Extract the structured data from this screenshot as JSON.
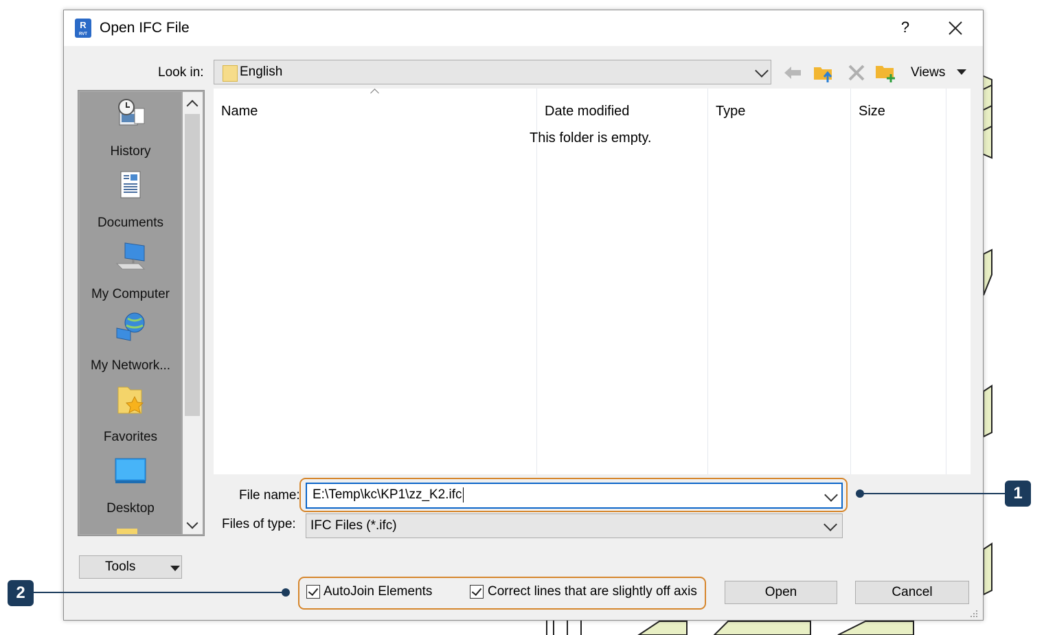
{
  "window": {
    "title": "Open IFC File",
    "app_icon": "revit-app-icon",
    "help": "?",
    "close": "×"
  },
  "lookin": {
    "label": "Look in:",
    "value": "English"
  },
  "toolbar": {
    "views_label": "Views",
    "icons": [
      "back-arrow-icon",
      "up-folder-icon",
      "delete-icon",
      "new-folder-icon"
    ]
  },
  "places": [
    {
      "label": "History",
      "icon": "history-icon"
    },
    {
      "label": "Documents",
      "icon": "documents-icon"
    },
    {
      "label": "My Computer",
      "icon": "my-computer-icon"
    },
    {
      "label": "My Network...",
      "icon": "my-network-icon"
    },
    {
      "label": "Favorites",
      "icon": "favorites-icon"
    },
    {
      "label": "Desktop",
      "icon": "desktop-icon"
    }
  ],
  "file_list": {
    "columns": [
      "Name",
      "Date modified",
      "Type",
      "Size"
    ],
    "empty_message": "This folder is empty."
  },
  "file_name": {
    "label": "File name:",
    "value": "E:\\Temp\\kc\\KP1\\zz_K2.ifc"
  },
  "file_type": {
    "label": "Files of type:",
    "value": "IFC Files (*.ifc)"
  },
  "tools_label": "Tools",
  "options": {
    "autojoin_label": "AutoJoin Elements",
    "autojoin_checked": true,
    "correct_lines_label": "Correct lines that are slightly off axis",
    "correct_lines_checked": true
  },
  "buttons": {
    "open": "Open",
    "cancel": "Cancel"
  },
  "callouts": [
    "1",
    "2"
  ],
  "colors": {
    "highlight": "#d6862c",
    "callout": "#1b3b5c",
    "focus_border": "#0a64c8"
  }
}
